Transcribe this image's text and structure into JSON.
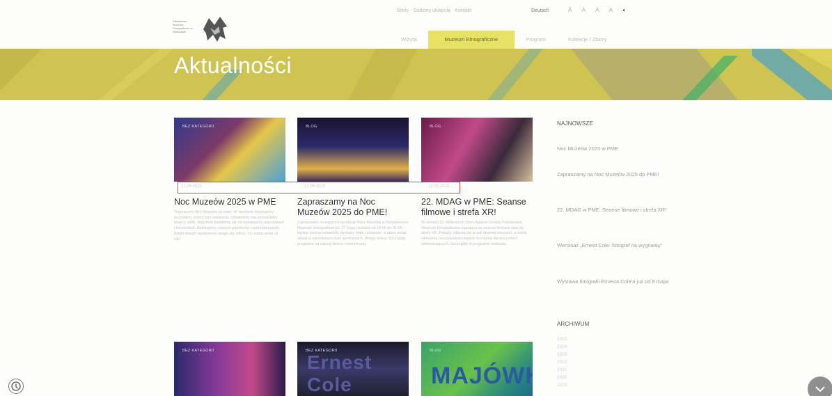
{
  "header": {
    "logo_text": "Państwowe Muzeum Etnograficzne w Warszawie",
    "top_links": [
      "Bilety",
      "Godziny otwarcia",
      "Kontakt"
    ],
    "language": "Deutsch",
    "access_items": [
      "Ă",
      "A",
      "A",
      "A"
    ],
    "contrast_icon": "contrast-icon",
    "nav": [
      {
        "label": "Wizyta",
        "active": false
      },
      {
        "label": "Muzeum Etnograficzne",
        "active": true
      },
      {
        "label": "Program",
        "active": false
      },
      {
        "label": "Kolekcje / Zbiory",
        "active": false
      }
    ]
  },
  "banner": {
    "title": "Aktualności"
  },
  "posts": [
    {
      "category": "BEZ KATEGORII",
      "date": "12.05.2025",
      "title": "Noc Muzeów 2025 w PME",
      "excerpt": "Tegoroczna Noc Muzeów za nami. W niedzielę dziękujemy wszystkim, którzy nas odwiedzili. Odwiedziło nas ponad kilka tysięcy osób. Wspólnie bawiliśmy się na wystawach, warsztatach i koncertach. Dziękujemy naszym partnerom i wolontariuszom, dzięki którym wydarzenie mogło się odbyć. Do zobaczenia za rok!",
      "colors": [
        "#2f3a8c",
        "#7d3a6a",
        "#e5c74a",
        "#4aa1d6"
      ]
    },
    {
      "category": "BLOG",
      "date": "12.05.2025",
      "title": "Zapraszamy na Noc Muzeów 2025 do PME!",
      "excerpt": "Zapraszamy na tegoroczną edycję Nocy Muzeów w Państwowym Muzeum Etnograficznym. 17 maja (sobota) od 18:00 do 01:00 będzie można odwiedzić wystawy stałe i czasowe, a także wziąć udział w warsztatach oraz spotkaniach. Wstęp wolny. Szczegóły programu na naszej stronie internetowej.",
      "colors": [
        "#1a1230",
        "#2b2a6a",
        "#e0b04a",
        "#3a2a5a"
      ]
    },
    {
      "category": "BLOG",
      "date": "12.05.2025",
      "title": "22. MDAG w PME: Seanse filmowe i strefa XR!",
      "excerpt": "W ramach 22. Millennium Docs Against Gravity Państwowe Muzeum Etnograficzne zaprasza na seanse filmowe oraz do strefy XR. Pokazy odbędą się w sali kinowej muzeum, a strefa wirtualnej rzeczywistości będzie dostępna dla wszystkich odwiedzających. Szczegóły w programie festiwalu.",
      "colors": [
        "#6a1a4a",
        "#c24a8a",
        "#3a2a3a",
        "#d8c0a0"
      ]
    },
    {
      "category": "BEZ KATEGORII",
      "title_overlay": "",
      "colors": [
        "#2a2a6a",
        "#8a3a9a",
        "#c24a8a",
        "#2a1a4a"
      ]
    },
    {
      "category": "BEZ KATEGORII",
      "title_overlay": "Ernest Cole",
      "colors": [
        "#1a1a2a",
        "#3a3a6a",
        "#5a5aa0",
        "#202030"
      ]
    },
    {
      "category": "BLOG",
      "title_overlay": "MAJÓWKA",
      "colors": [
        "#3aa36a",
        "#6ac24a",
        "#2a8a7a",
        "#1f6a8a"
      ]
    }
  ],
  "sidebar": {
    "newest_heading": "NAJNOWSZE",
    "newest": [
      "Noc Muzeów 2025 w PME",
      "Zapraszamy na Noc Muzeów 2025 do PME!",
      "22. MDAG w PME: Seanse filmowe i strefa XR!",
      "Wernisaż „Ernest Cole: fotograf na wygnaniu”",
      "Wystawa fotografii Ernesta Cole'a już od 8 maja!"
    ],
    "archive_heading": "ARCHIWUM",
    "years": [
      "2025",
      "2024",
      "2023",
      "2022",
      "2021",
      "2020",
      "2019"
    ]
  },
  "floating": {
    "left_icon": "accessibility-icon",
    "right_icon": "chevron-down-icon"
  },
  "colors": {
    "banner": "#cfc451",
    "nav_active": "#e8e264",
    "highlight": "#e0443e"
  }
}
